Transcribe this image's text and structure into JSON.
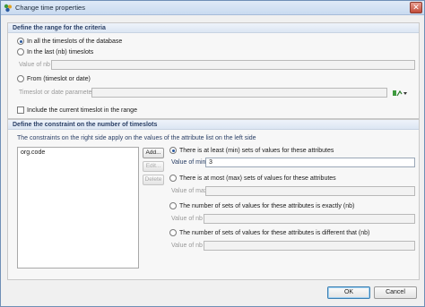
{
  "window": {
    "title": "Change time properties"
  },
  "criteria": {
    "heading": "Define the range for the criteria",
    "opt_all": "In all the timeslots of the database",
    "opt_last": "In the last (nb) timeslots",
    "value_nb_label": "Value of nb",
    "opt_from": "From (timeslot or date)",
    "param_label": "Timeslot or date parameter",
    "include_current": "Include the current timeslot in the range"
  },
  "constraint": {
    "heading": "Define the constraint on the number of timeslots",
    "note": "The constraints on the right side apply on the values of the attribute list on the left side",
    "attributes": [
      "org.code"
    ],
    "add_label": "Add...",
    "edit_label": "Edit...",
    "delete_label": "Delete",
    "opt_min": "There is at least (min) sets of values for these attributes",
    "value_min_label": "Value of min",
    "value_min": "3",
    "opt_max": "There is at most (max) sets of values for these attributes",
    "value_max_label": "Value of max",
    "opt_exact": "The number of sets of values for these attributes is exactly (nb)",
    "value_nb_label_exact": "Value of nb",
    "opt_diff": "The number of sets of values for these attributes is different that (nb)",
    "value_nb_label_diff": "Value of nb"
  },
  "footer": {
    "ok_label": "OK",
    "cancel_label": "Cancel"
  },
  "colors": {
    "accent": "#2a5aa0",
    "header_text": "#2a3f66",
    "icon_green": "#3d9a3d"
  }
}
